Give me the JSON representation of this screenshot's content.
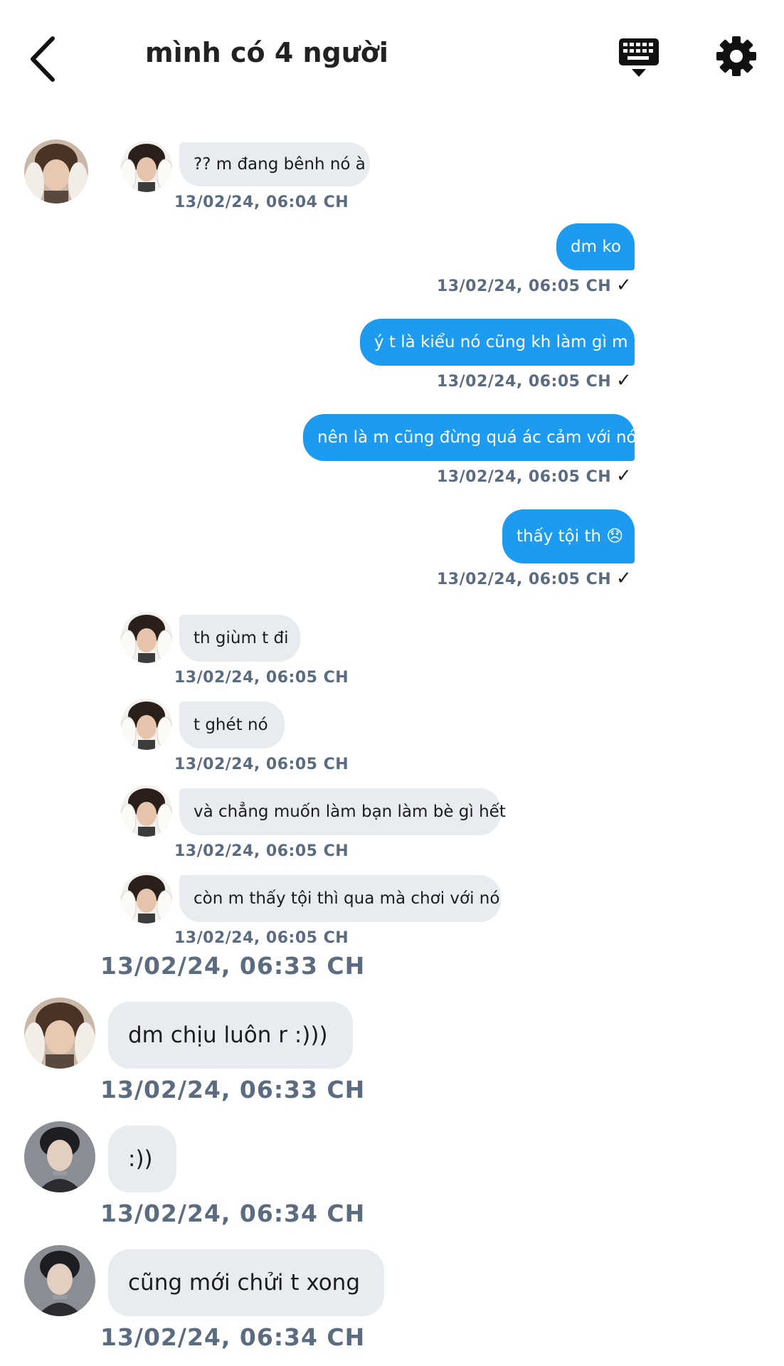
{
  "header": {
    "title": "mình có 4 người"
  },
  "colors": {
    "outgoing_bubble": "#1d9bf0",
    "incoming_bubble": "#e8ecf1",
    "timestamp": "#5b6b80"
  },
  "messages": [
    {
      "text": "?? m đang bênh nó à",
      "time": "13/02/24, 06:04 CH",
      "dir": "in"
    },
    {
      "text": "dm ko",
      "time": "13/02/24, 06:05 CH",
      "dir": "out"
    },
    {
      "text": "ý t là kiểu nó cũng kh làm gì m í",
      "time": "13/02/24, 06:05 CH",
      "dir": "out"
    },
    {
      "text": "nên là m cũng đừng quá ác cảm với nó",
      "time": "13/02/24, 06:05 CH",
      "dir": "out"
    },
    {
      "text": "thấy tội th 😞",
      "time": "13/02/24, 06:05 CH",
      "dir": "out"
    },
    {
      "text": "th giùm t đi",
      "time": "13/02/24, 06:05 CH",
      "dir": "in"
    },
    {
      "text": "t ghét nó",
      "time": "13/02/24, 06:05 CH",
      "dir": "in"
    },
    {
      "text": "và chẳng muốn làm bạn làm bè gì hết",
      "time": "13/02/24, 06:05 CH",
      "dir": "in"
    },
    {
      "text": "còn m thấy tội thì qua mà chơi với nó",
      "time": "13/02/24, 06:05 CH",
      "dir": "in"
    },
    {
      "text": "",
      "time": "13/02/24, 06:33 CH",
      "dir": "in"
    },
    {
      "text": "dm chịu luôn r :)))",
      "time": "13/02/24, 06:33 CH",
      "dir": "in"
    },
    {
      "text": ":))",
      "time": "13/02/24, 06:34 CH",
      "dir": "in"
    },
    {
      "text": "cũng mới chửi t xong",
      "time": "13/02/24, 06:34 CH",
      "dir": "in"
    }
  ],
  "icons": {
    "back": "chevron-left-icon",
    "keyboard": "keyboard-icon",
    "settings": "gear-icon",
    "read": "checkmark-icon"
  },
  "read_mark": "✓"
}
